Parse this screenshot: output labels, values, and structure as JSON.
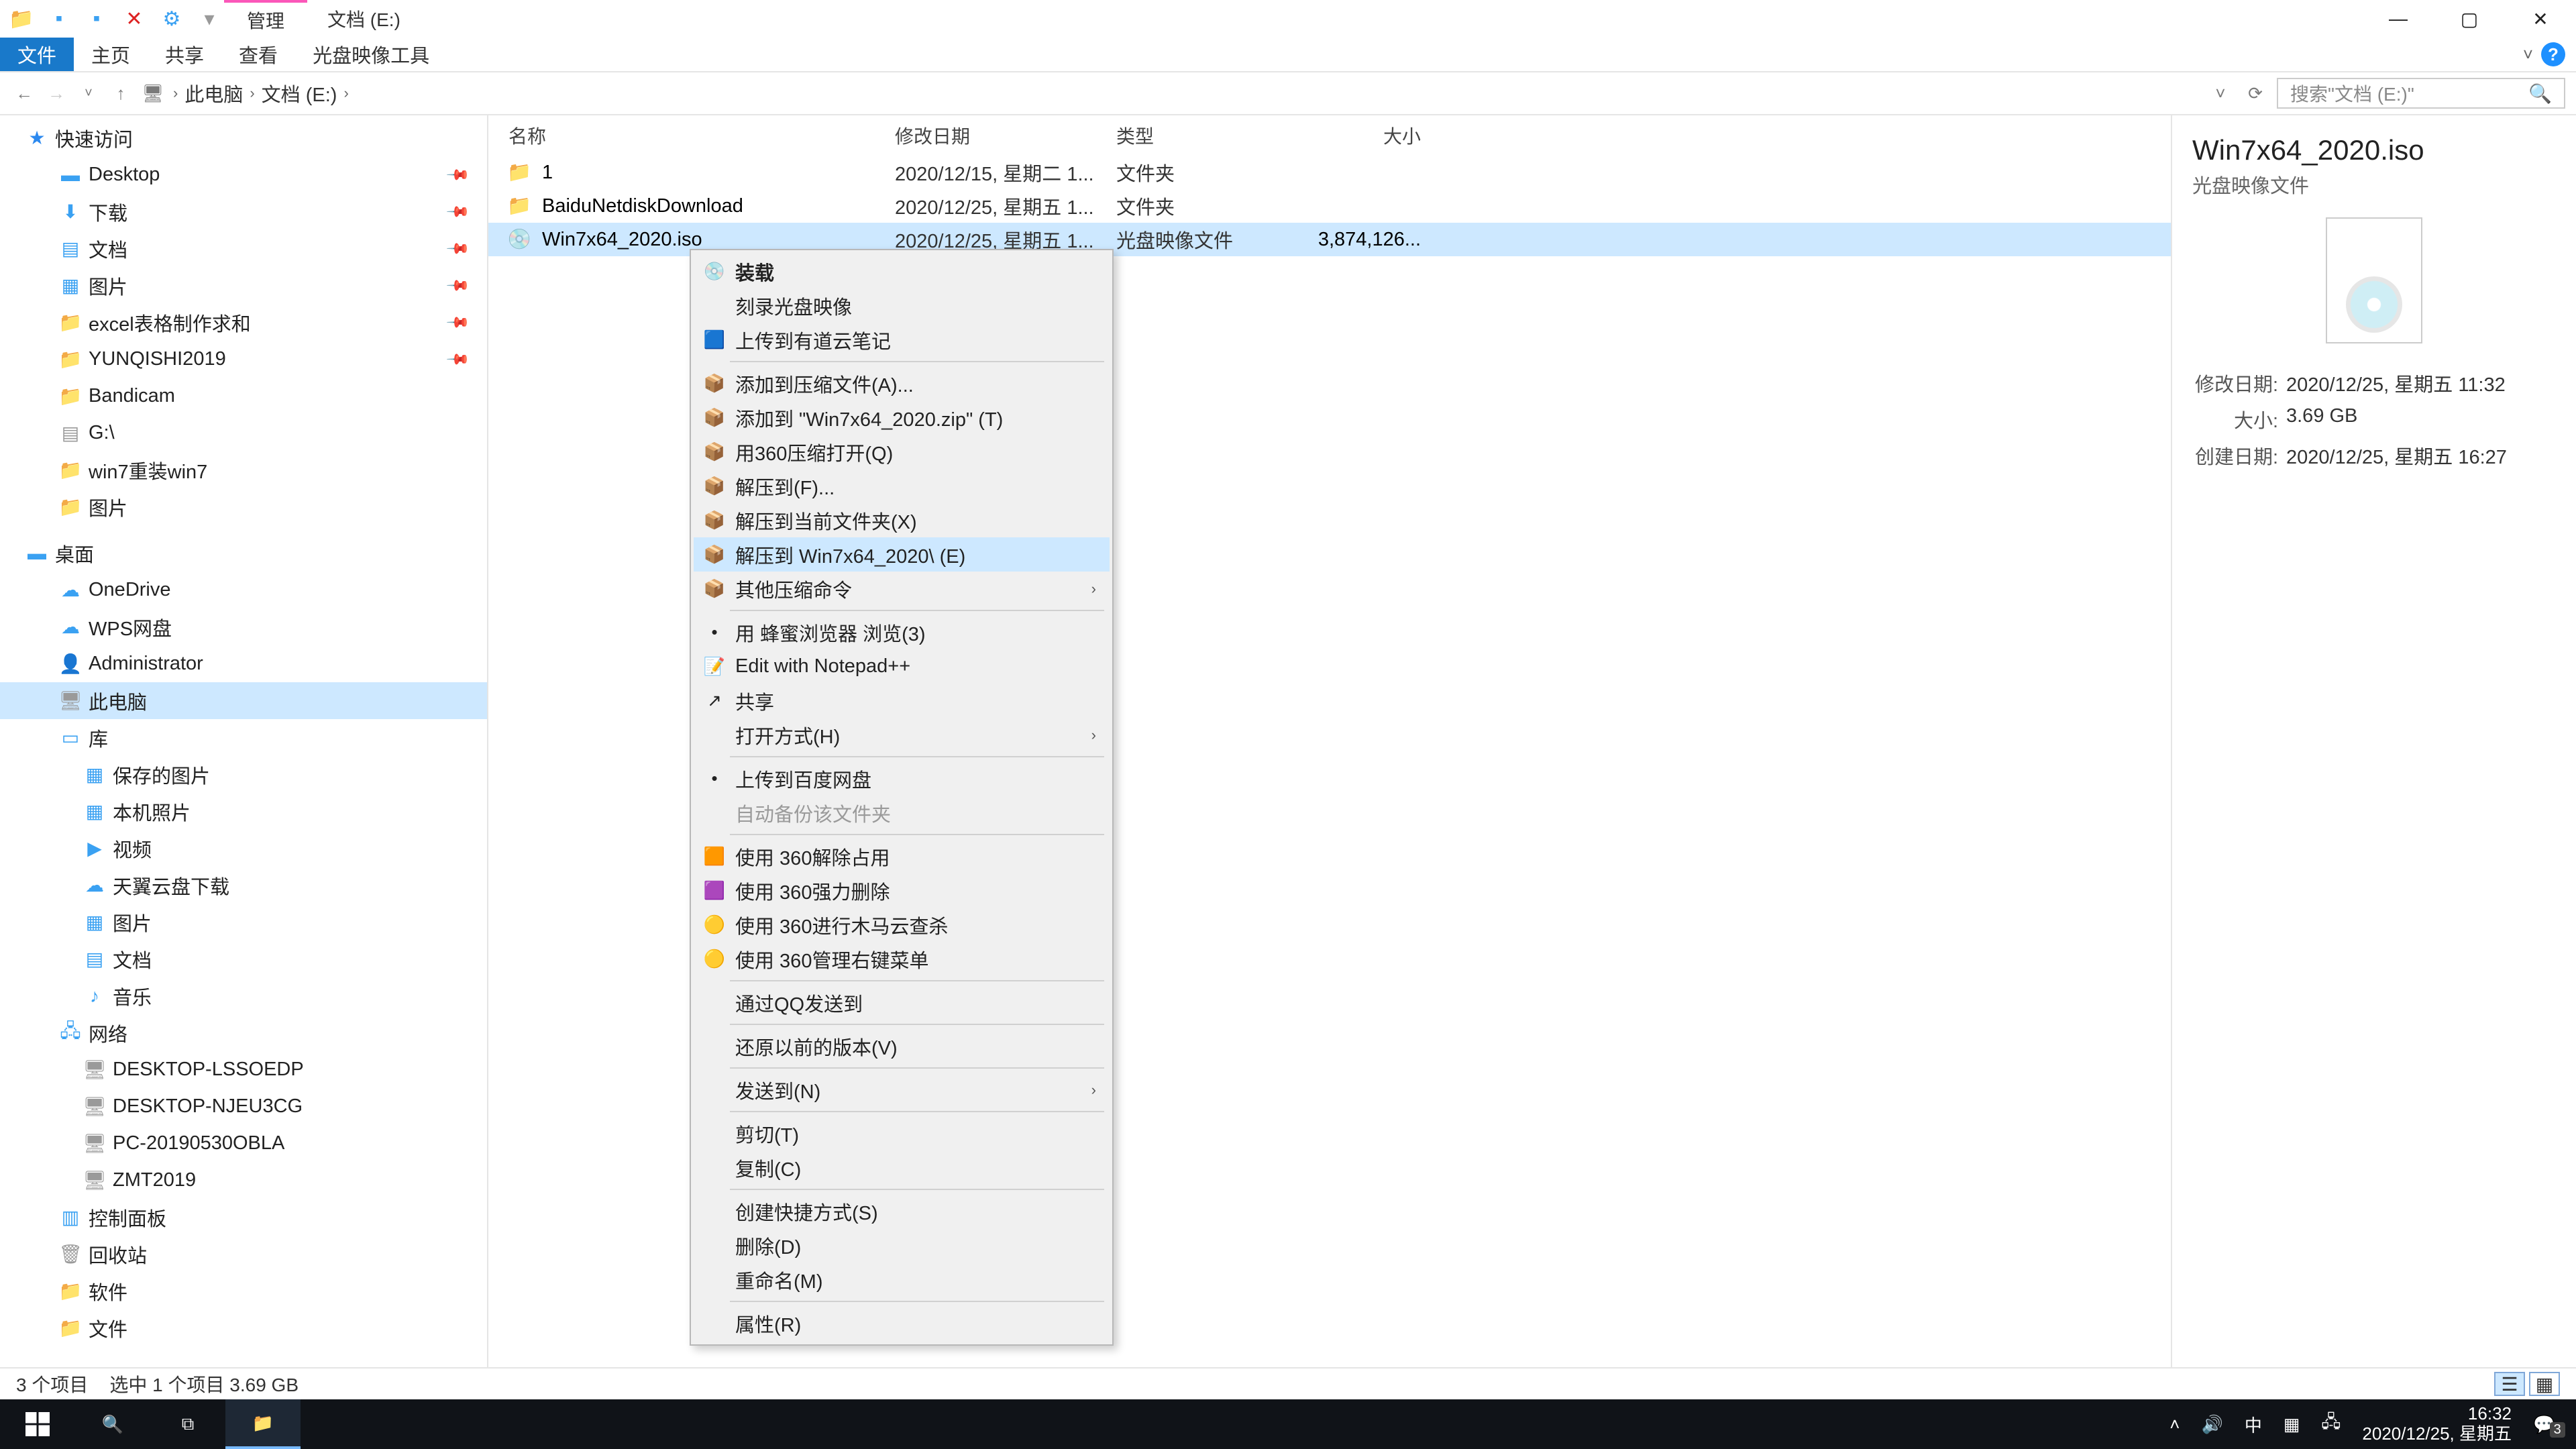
{
  "window": {
    "context_tab": "管理",
    "title_tab": "文档 (E:)",
    "ribbon": {
      "file": "文件",
      "home": "主页",
      "share": "共享",
      "view": "查看",
      "disc": "光盘映像工具"
    }
  },
  "breadcrumb": {
    "root": "此电脑",
    "folder": "文档 (E:)"
  },
  "search": {
    "placeholder": "搜索\"文档 (E:)\""
  },
  "nav": {
    "quick": "快速访问",
    "items_quick": [
      "Desktop",
      "下载",
      "文档",
      "图片",
      "excel表格制作求和",
      "YUNQISHI2019",
      "Bandicam",
      "G:\\",
      "win7重装win7",
      "图片"
    ],
    "desktop": "桌面",
    "items_desktop": [
      "OneDrive",
      "WPS网盘",
      "Administrator",
      "此电脑",
      "库"
    ],
    "lib": [
      "保存的图片",
      "本机照片",
      "视频",
      "天翼云盘下载",
      "图片",
      "文档",
      "音乐"
    ],
    "network": "网络",
    "items_net": [
      "DESKTOP-LSSOEDP",
      "DESKTOP-NJEU3CG",
      "PC-20190530OBLA",
      "ZMT2019"
    ],
    "bottom": [
      "控制面板",
      "回收站",
      "软件",
      "文件"
    ]
  },
  "columns": {
    "name": "名称",
    "date": "修改日期",
    "type": "类型",
    "size": "大小"
  },
  "rows": [
    {
      "name": "1",
      "date": "2020/12/15, 星期二 1...",
      "type": "文件夹",
      "size": ""
    },
    {
      "name": "BaiduNetdiskDownload",
      "date": "2020/12/25, 星期五 1...",
      "type": "文件夹",
      "size": ""
    },
    {
      "name": "Win7x64_2020.iso",
      "date": "2020/12/25, 星期五 1...",
      "type": "光盘映像文件",
      "size": "3,874,126..."
    }
  ],
  "ctx": [
    {
      "t": "装载",
      "bold": true,
      "ic": "💿"
    },
    {
      "t": "刻录光盘映像"
    },
    {
      "t": "上传到有道云笔记",
      "ic": "🟦"
    },
    {
      "div": true
    },
    {
      "t": "添加到压缩文件(A)...",
      "ic": "📦"
    },
    {
      "t": "添加到 \"Win7x64_2020.zip\" (T)",
      "ic": "📦"
    },
    {
      "t": "用360压缩打开(Q)",
      "ic": "📦"
    },
    {
      "t": "解压到(F)...",
      "ic": "📦"
    },
    {
      "t": "解压到当前文件夹(X)",
      "ic": "📦"
    },
    {
      "t": "解压到 Win7x64_2020\\ (E)",
      "ic": "📦",
      "hover": true
    },
    {
      "t": "其他压缩命令",
      "ic": "📦",
      "sub": true
    },
    {
      "div": true
    },
    {
      "t": "用 蜂蜜浏览器 浏览(3)",
      "ic": "•"
    },
    {
      "t": "Edit with Notepad++",
      "ic": "📝"
    },
    {
      "t": "共享",
      "ic": "↗"
    },
    {
      "t": "打开方式(H)",
      "sub": true
    },
    {
      "div": true
    },
    {
      "t": "上传到百度网盘",
      "ic": "•"
    },
    {
      "t": "自动备份该文件夹",
      "dis": true
    },
    {
      "div": true
    },
    {
      "t": "使用 360解除占用",
      "ic": "🟧"
    },
    {
      "t": "使用 360强力删除",
      "ic": "🟪"
    },
    {
      "t": "使用 360进行木马云查杀",
      "ic": "🟡"
    },
    {
      "t": "使用 360管理右键菜单",
      "ic": "🟡"
    },
    {
      "div": true
    },
    {
      "t": "通过QQ发送到"
    },
    {
      "div": true
    },
    {
      "t": "还原以前的版本(V)"
    },
    {
      "div": true
    },
    {
      "t": "发送到(N)",
      "sub": true
    },
    {
      "div": true
    },
    {
      "t": "剪切(T)"
    },
    {
      "t": "复制(C)"
    },
    {
      "div": true
    },
    {
      "t": "创建快捷方式(S)"
    },
    {
      "t": "删除(D)"
    },
    {
      "t": "重命名(M)"
    },
    {
      "div": true
    },
    {
      "t": "属性(R)"
    }
  ],
  "details": {
    "title": "Win7x64_2020.iso",
    "kind": "光盘映像文件",
    "k_modified": "修改日期:",
    "v_modified": "2020/12/25, 星期五 11:32",
    "k_size": "大小:",
    "v_size": "3.69 GB",
    "k_created": "创建日期:",
    "v_created": "2020/12/25, 星期五 16:27"
  },
  "status": {
    "count": "3 个项目",
    "sel": "选中 1 个项目  3.69 GB"
  },
  "taskbar": {
    "ime": "中",
    "time": "16:32",
    "date": "2020/12/25, 星期五",
    "notif": "3"
  }
}
